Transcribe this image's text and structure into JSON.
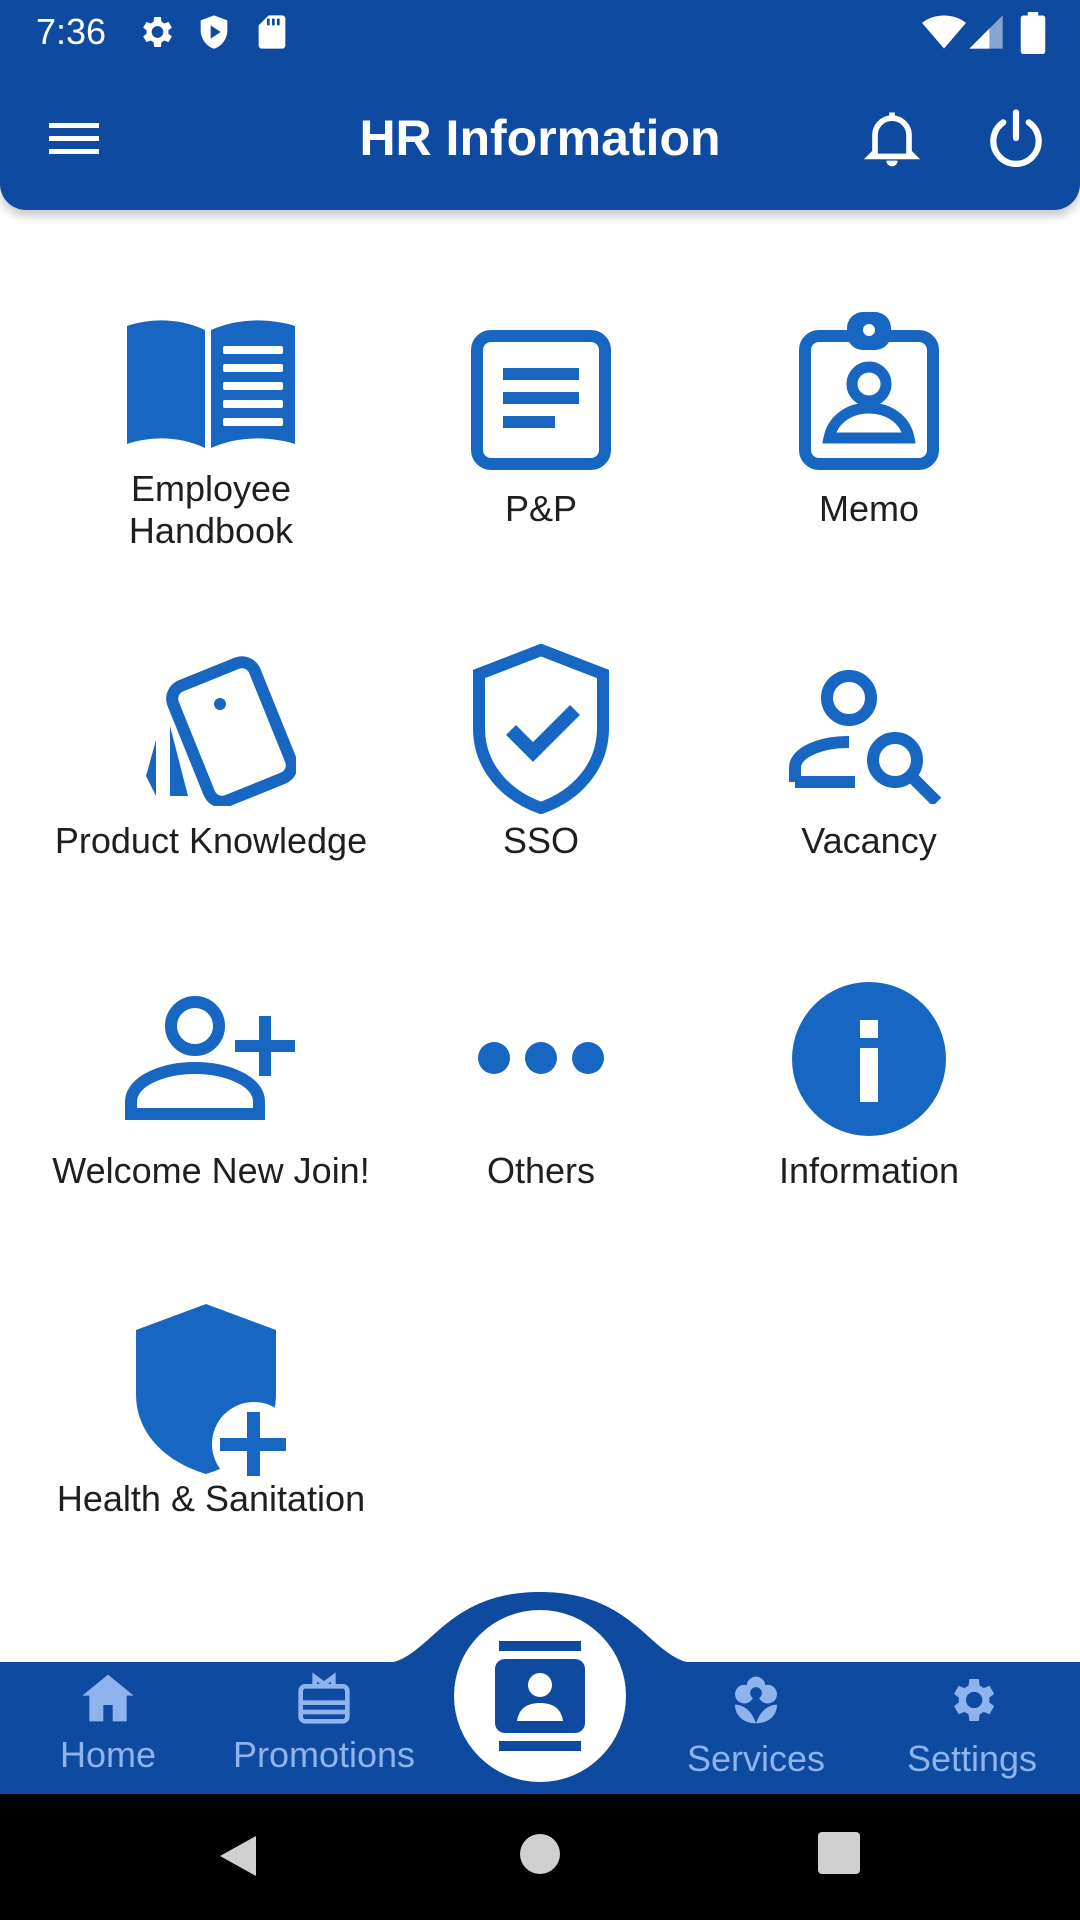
{
  "status_bar": {
    "time": "7:36"
  },
  "app_bar": {
    "title": "HR Information",
    "menu_icon": "menu-icon",
    "notification_icon": "bell-icon",
    "power_icon": "power-icon"
  },
  "grid": {
    "items": [
      {
        "label": "Employee\nHandbook",
        "icon": "book-icon"
      },
      {
        "label": "P&P",
        "icon": "document-icon"
      },
      {
        "label": "Memo",
        "icon": "badge-icon"
      },
      {
        "label": "Product Knowledge",
        "icon": "cards-icon"
      },
      {
        "label": "SSO",
        "icon": "shield-check-icon"
      },
      {
        "label": "Vacancy",
        "icon": "person-search-icon"
      },
      {
        "label": "Welcome New Join!",
        "icon": "person-add-icon"
      },
      {
        "label": "Others",
        "icon": "more-icon"
      },
      {
        "label": "Information",
        "icon": "info-icon"
      },
      {
        "label": "Health & Sanitation",
        "icon": "health-shield-icon"
      }
    ]
  },
  "bottom_nav": {
    "items": [
      {
        "label": "Home",
        "icon": "home-icon"
      },
      {
        "label": "Promotions",
        "icon": "gift-icon"
      },
      {
        "label": "Services",
        "icon": "flower-icon"
      },
      {
        "label": "Settings",
        "icon": "gear-icon"
      }
    ],
    "center": {
      "icon": "contact-badge-icon"
    }
  },
  "colors": {
    "primary": "#0f4aa1",
    "icon_blue": "#1766c2",
    "nav_inactive": "#8fb3ec"
  }
}
